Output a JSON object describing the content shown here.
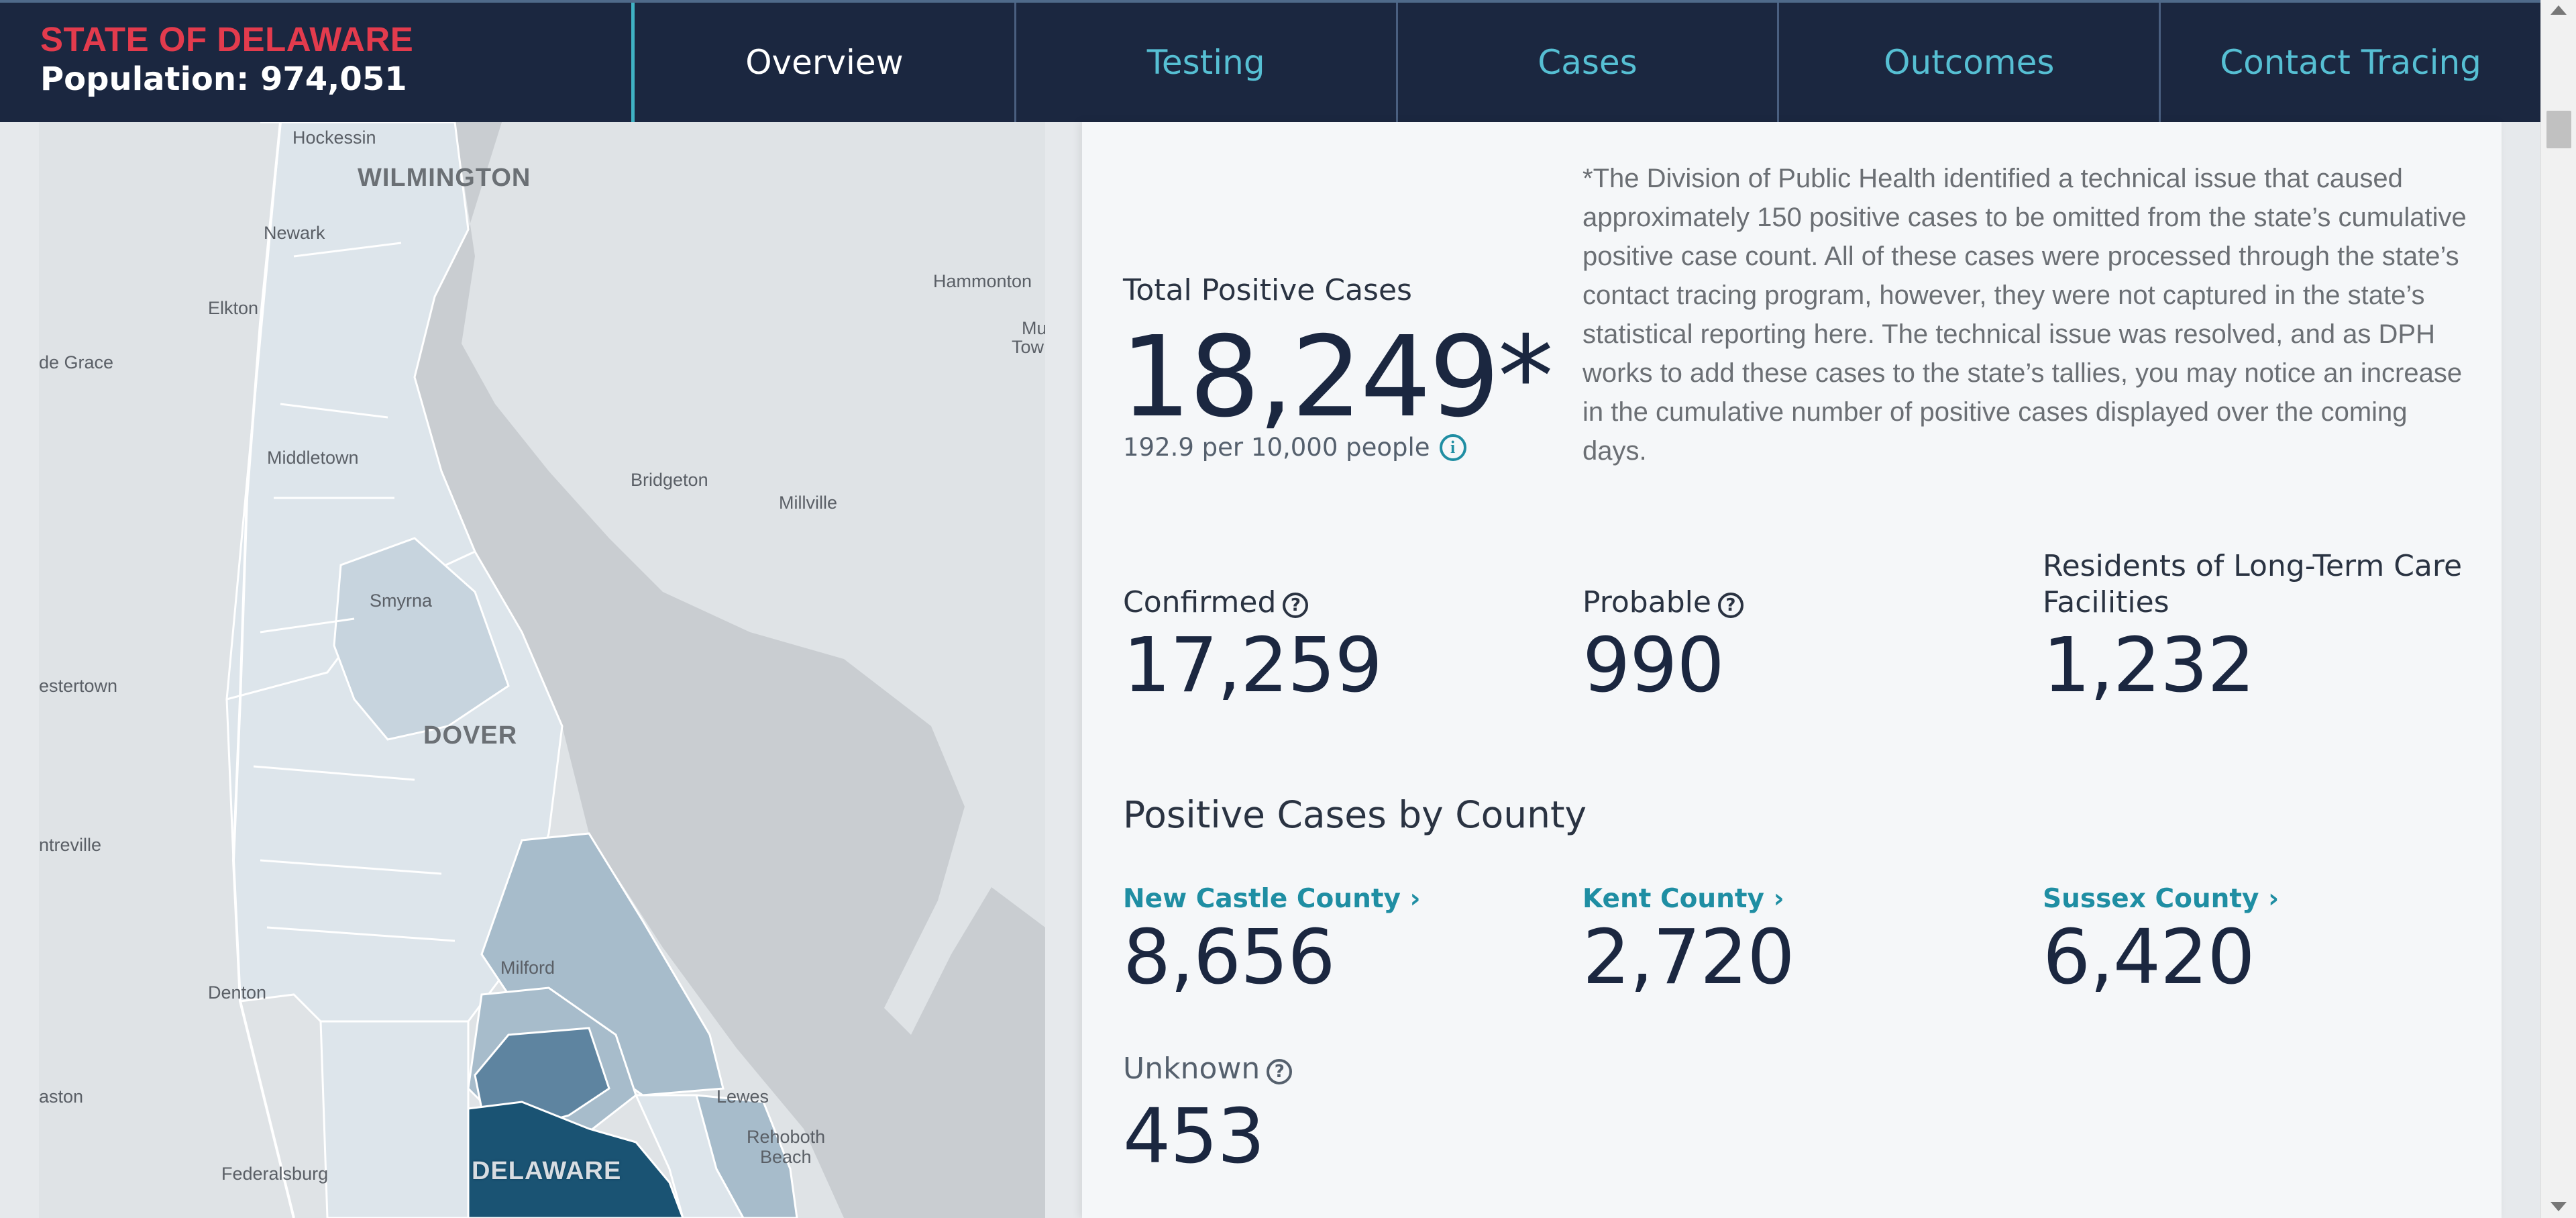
{
  "header": {
    "state_name": "STATE OF DELAWARE",
    "population": "Population: 974,051",
    "tabs": [
      {
        "label": "Overview",
        "active": true
      },
      {
        "label": "Testing",
        "active": false
      },
      {
        "label": "Cases",
        "active": false
      },
      {
        "label": "Outcomes",
        "active": false
      },
      {
        "label": "Contact Tracing",
        "active": false
      }
    ]
  },
  "map": {
    "labels": {
      "hockessin": "Hockessin",
      "wilmington": "WILMINGTON",
      "newark": "Newark",
      "elkton": "Elkton",
      "havre_de_grace": "de Grace",
      "hammonton": "Hammonton",
      "mu": "Mu",
      "tow": "Tow",
      "middletown": "Middletown",
      "bridgeton": "Bridgeton",
      "millville": "Millville",
      "smyrna": "Smyrna",
      "chestertown": "estertown",
      "dover": "DOVER",
      "centreville": "ntreville",
      "milford": "Milford",
      "denton": "Denton",
      "easton": "aston",
      "lewes": "Lewes",
      "rehoboth": "Rehoboth",
      "beach": "Beach",
      "federalsburg": "Federalsburg",
      "delaware": "DELAWARE"
    },
    "colors": {
      "water": "#c9cdd1",
      "land": "#dfe3e6",
      "light": "#dde5eb",
      "medium": "#a7bccb",
      "dark": "#5e84a0",
      "darkest": "#1a5373"
    }
  },
  "summary": {
    "total_label": "Total Positive Cases",
    "total_value": "18,249*",
    "per_capita": "192.9 per 10,000 people",
    "note": "*The Division of Public Health identified a technical issue that caused approximately 150 positive cases to be omitted from the state’s cumulative positive case count. All of these cases were processed through the state’s contact tracing program, however, they were not captured in the state’s statistical reporting here. The technical issue was resolved, and as DPH works to add these cases to the state’s tallies, you may notice an increase in the cumulative number of positive cases displayed over the coming days."
  },
  "breakdown": {
    "confirmed_label": "Confirmed",
    "confirmed_value": "17,259",
    "probable_label": "Probable",
    "probable_value": "990",
    "ltc_label_line1": "Residents of Long-Term Care",
    "ltc_label_line2": "Facilities",
    "ltc_value": "1,232"
  },
  "county": {
    "title": "Positive Cases by County",
    "new_castle_label": "New Castle County",
    "new_castle_value": "8,656",
    "kent_label": "Kent County",
    "kent_value": "2,720",
    "sussex_label": "Sussex County",
    "sussex_value": "6,420",
    "unknown_label": "Unknown",
    "unknown_value": "453"
  },
  "icons": {
    "help": "?",
    "info": "i",
    "chevron": "›"
  }
}
